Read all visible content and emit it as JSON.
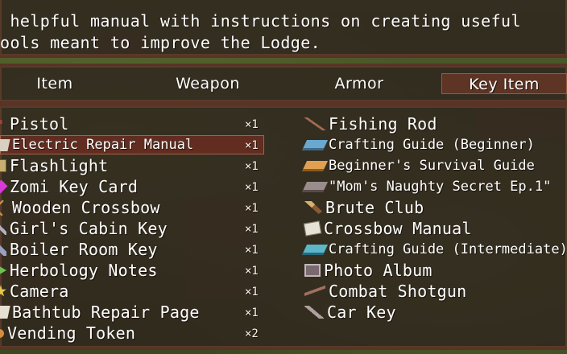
{
  "help": {
    "line1": " helpful manual with instructions on creating useful",
    "line2": "ools meant to improve the Lodge."
  },
  "tabs": [
    {
      "label": "Item",
      "selected": false
    },
    {
      "label": "Weapon",
      "selected": false
    },
    {
      "label": "Armor",
      "selected": false
    },
    {
      "label": "Key Item",
      "selected": true
    }
  ],
  "items_left": [
    {
      "name": "Pistol",
      "qty": "×1",
      "icon": "pistol-icon"
    },
    {
      "name": "Electric Repair Manual",
      "qty": "×1",
      "icon": "manual-icon",
      "selected": true
    },
    {
      "name": "Flashlight",
      "qty": "×1",
      "icon": "flashlight-icon"
    },
    {
      "name": "Zomi Key Card",
      "qty": "×1",
      "icon": "keycard-icon"
    },
    {
      "name": "Wooden Crossbow",
      "qty": "×1",
      "icon": "crossbow-icon"
    },
    {
      "name": "Girl's Cabin Key",
      "qty": "×1",
      "icon": "key-icon"
    },
    {
      "name": "Boiler Room Key",
      "qty": "×1",
      "icon": "key-icon"
    },
    {
      "name": "Herbology Notes",
      "qty": "×1",
      "icon": "herb-icon"
    },
    {
      "name": "Camera",
      "qty": "×1",
      "icon": "camera-icon"
    },
    {
      "name": "Bathtub Repair Page",
      "qty": "×1",
      "icon": "page-icon"
    },
    {
      "name": "Vending Token",
      "qty": "×2",
      "icon": "token-icon"
    }
  ],
  "items_right": [
    {
      "name": "Fishing Rod",
      "qty": "×",
      "icon": "fishing-rod-icon"
    },
    {
      "name": "Crafting Guide (Beginner)",
      "qty": "×",
      "icon": "book-icon"
    },
    {
      "name": "Beginner's Survival Guide",
      "qty": "×",
      "icon": "book-icon"
    },
    {
      "name": "\"Mom's Naughty Secret Ep.1\"",
      "qty": "×",
      "icon": "book-icon"
    },
    {
      "name": "Brute Club",
      "qty": "×",
      "icon": "club-icon"
    },
    {
      "name": "Crossbow Manual",
      "qty": "×",
      "icon": "scroll-icon"
    },
    {
      "name": "Crafting Guide (Intermediate)",
      "qty": "×",
      "icon": "book-icon"
    },
    {
      "name": "Photo Album",
      "qty": "×",
      "icon": "album-icon"
    },
    {
      "name": "Combat Shotgun",
      "qty": "×",
      "icon": "shotgun-icon"
    },
    {
      "name": "Car Key",
      "qty": "×",
      "icon": "car-key-icon"
    }
  ]
}
